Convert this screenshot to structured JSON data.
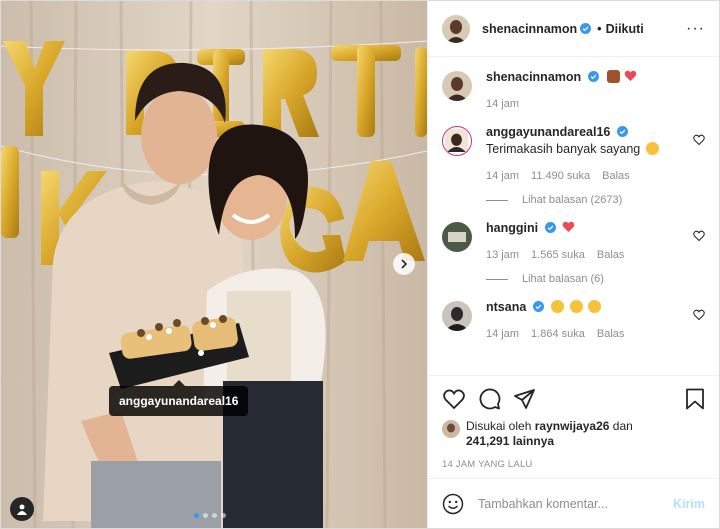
{
  "photo": {
    "tag_username": "anggayunandareal16",
    "balloon_text": "Y BIRTH  ANGA",
    "carousel_pages": 4,
    "carousel_active": 1
  },
  "header": {
    "username": "shenacinnamon",
    "separator": "•",
    "follow_status": "Diikuti",
    "more": "···"
  },
  "caption": {
    "username": "shenacinnamon",
    "emojis": [
      "cake-emoji",
      "red-heart-emoji"
    ],
    "time": "14 jam"
  },
  "comments": [
    {
      "username": "anggayunandareal16",
      "text": "Terimakasih banyak sayang",
      "emoji": "smiling-hearts-emoji",
      "time": "14 jam",
      "likes": "11.490 suka",
      "reply": "Balas",
      "view_replies": "Lihat balasan (2673)"
    },
    {
      "username": "hanggini",
      "text": "",
      "emoji": "red-heart-emoji",
      "time": "13 jam",
      "likes": "1.565 suka",
      "reply": "Balas",
      "view_replies": "Lihat balasan (6)"
    },
    {
      "username": "ntsana",
      "text": "",
      "emoji": "heart-eyes-emoji",
      "time": "14 jam",
      "likes": "1.864 suka",
      "reply": "Balas"
    }
  ],
  "likes": {
    "prefix": "Disukai oleh",
    "user": "raynwijaya26",
    "connector": "dan",
    "others": "241,291 lainnya"
  },
  "timestamp": "14 JAM YANG LALU",
  "add_comment": {
    "placeholder": "Tambahkan komentar...",
    "post_label": "Kirim"
  },
  "colors": {
    "verified": "#3897f0",
    "heart": "#ed4956",
    "post_disabled": "#b2dffc",
    "balloon_gold": "#d9a82a"
  }
}
